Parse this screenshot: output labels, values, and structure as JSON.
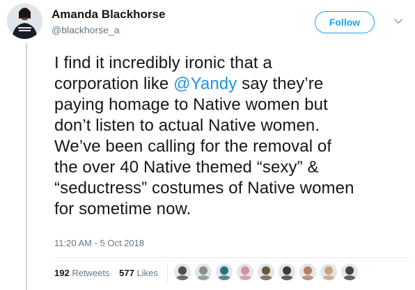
{
  "author": {
    "display_name": "Amanda Blackhorse",
    "handle": "@blackhorse_a"
  },
  "header": {
    "follow_label": "Follow"
  },
  "tweet": {
    "lines": [
      [
        "I find it incredibly ironic that a"
      ],
      [
        "corporation like ",
        "@Yandy",
        " say they’re"
      ],
      [
        "paying homage to Native women but"
      ],
      [
        "don’t listen to actual Native women."
      ],
      [
        "We’ve been calling for the removal of"
      ],
      [
        "the over 40 Native themed “sexy” &"
      ],
      [
        "“seductress” costumes of Native women"
      ],
      [
        "for sometime now."
      ]
    ],
    "timestamp": "11:20 AM - 5 Oct 2018"
  },
  "stats": {
    "retweets_count": "192",
    "retweets_label": "Retweets",
    "likes_count": "577",
    "likes_label": "Likes"
  },
  "likers": [
    {
      "color": "#5a4a42"
    },
    {
      "color": "#8a8f88"
    },
    {
      "color": "#2f6f7a"
    },
    {
      "color": "#d98ca8"
    },
    {
      "color": "#6b5a3a"
    },
    {
      "color": "#3a3a3a"
    },
    {
      "color": "#b88060"
    },
    {
      "color": "#c9a27e"
    },
    {
      "color": "#4a4038"
    }
  ],
  "colors": {
    "accent": "#1da1f2",
    "mention": "#1b95e0",
    "secondary_text": "#657786"
  }
}
